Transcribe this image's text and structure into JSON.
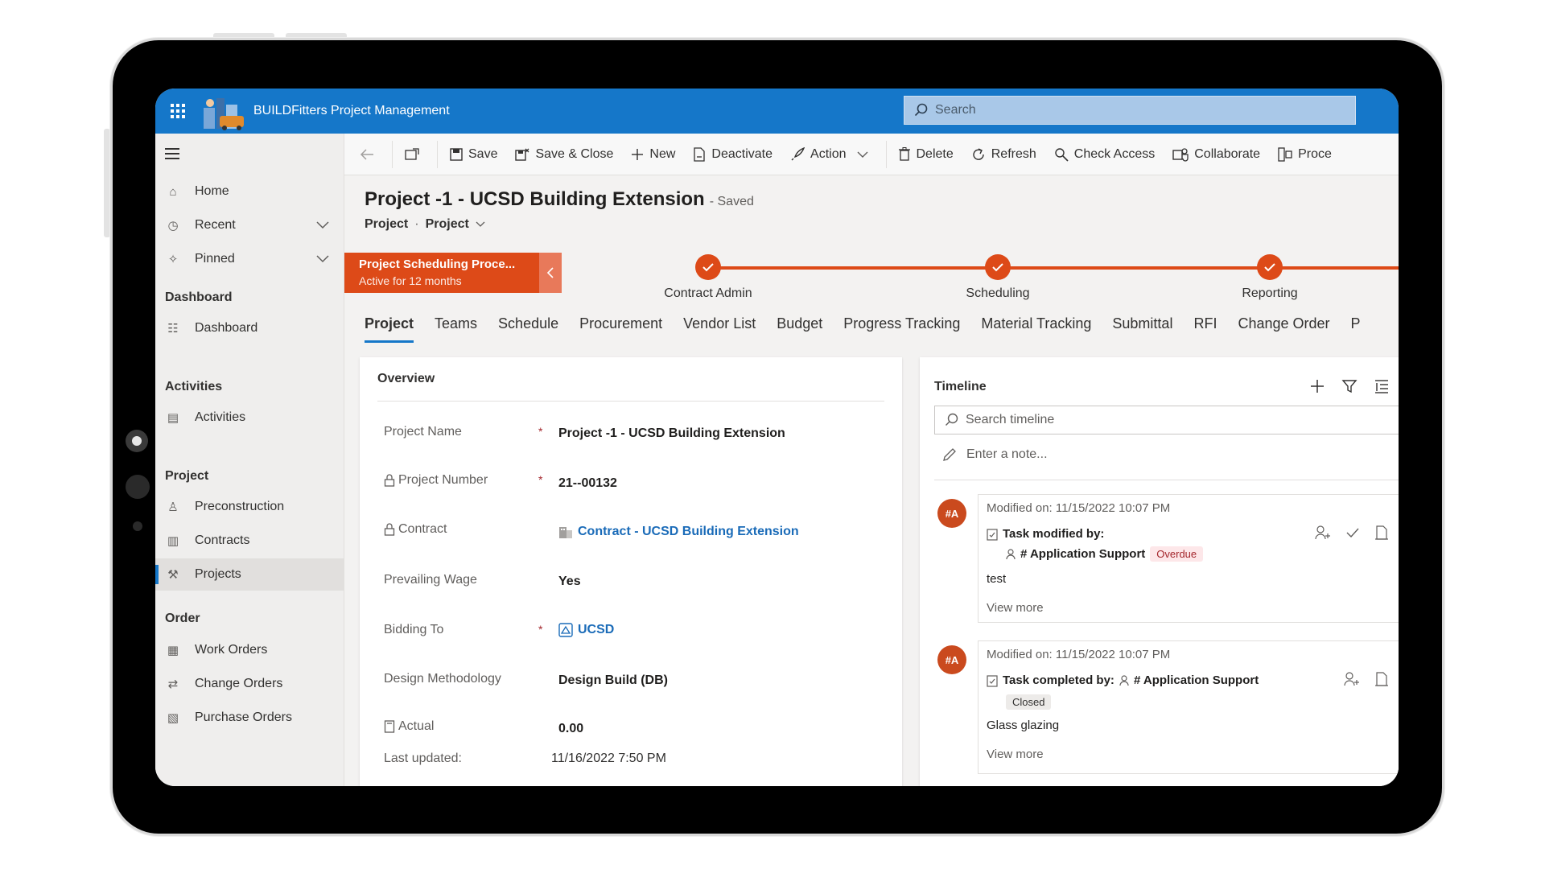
{
  "app": {
    "title": "BUILDFitters Project Management"
  },
  "search": {
    "placeholder": "Search"
  },
  "sidebar": {
    "items": [
      {
        "label": "Home",
        "icon": "home-icon"
      },
      {
        "label": "Recent",
        "icon": "clock-icon"
      },
      {
        "label": "Pinned",
        "icon": "pin-icon"
      }
    ],
    "groups": [
      {
        "title": "Dashboard",
        "items": [
          {
            "label": "Dashboard"
          }
        ]
      },
      {
        "title": "Activities",
        "items": [
          {
            "label": "Activities"
          }
        ]
      },
      {
        "title": "Project",
        "items": [
          {
            "label": "Preconstruction"
          },
          {
            "label": "Contracts"
          },
          {
            "label": "Projects"
          }
        ]
      },
      {
        "title": "Order",
        "items": [
          {
            "label": "Work Orders"
          },
          {
            "label": "Change Orders"
          },
          {
            "label": "Purchase Orders"
          }
        ]
      }
    ]
  },
  "commands": {
    "save": "Save",
    "save_close": "Save & Close",
    "new": "New",
    "deactivate": "Deactivate",
    "action": "Action",
    "delete": "Delete",
    "refresh": "Refresh",
    "check_access": "Check Access",
    "collaborate": "Collaborate",
    "process": "Proce"
  },
  "record": {
    "title": "Project -1 - UCSD Building Extension",
    "status": "- Saved",
    "entity": "Project",
    "form": "Project"
  },
  "bpf": {
    "active_name": "Project Scheduling Proce...",
    "active_duration": "Active for 12 months",
    "stages": [
      "Contract Admin",
      "Scheduling",
      "Reporting"
    ]
  },
  "tabs": [
    "Project",
    "Teams",
    "Schedule",
    "Procurement",
    "Vendor List",
    "Budget",
    "Progress Tracking",
    "Material Tracking",
    "Submittal",
    "RFI",
    "Change Order",
    "P"
  ],
  "overview": {
    "title": "Overview",
    "fields": [
      {
        "label": "Project Name",
        "value": "Project -1 - UCSD Building Extension"
      },
      {
        "label": "Project Number",
        "value": "21--00132"
      },
      {
        "label": "Contract",
        "value": "Contract - UCSD Building Extension"
      },
      {
        "label": "Prevailing Wage",
        "value": "Yes"
      },
      {
        "label": "Bidding To",
        "value": "UCSD"
      },
      {
        "label": "Design Methodology",
        "value": "Design Build (DB)"
      },
      {
        "label": "Actual",
        "value": "0.00"
      },
      {
        "label": "Last updated:",
        "value": "11/16/2022 7:50 PM"
      }
    ],
    "required_mark": "*"
  },
  "timeline": {
    "title": "Timeline",
    "search_placeholder": "Search timeline",
    "note_placeholder": "Enter a note...",
    "posts": [
      {
        "avatar": "#A",
        "modified": "Modified on: 11/15/2022 10:07 PM",
        "headline": "Task modified by:",
        "user": "# Application Support",
        "badge": "Overdue",
        "body": "test",
        "more": "View more"
      },
      {
        "avatar": "#A",
        "modified": "Modified on: 11/15/2022 10:07 PM",
        "headline": "Task completed by:",
        "user": "# Application Support",
        "badge": "Closed",
        "body": "Glass glazing",
        "more": "View more"
      }
    ]
  },
  "colors": {
    "brand": "#1577c9",
    "bpf": "#dd4a18",
    "link": "#1a6bb8"
  }
}
